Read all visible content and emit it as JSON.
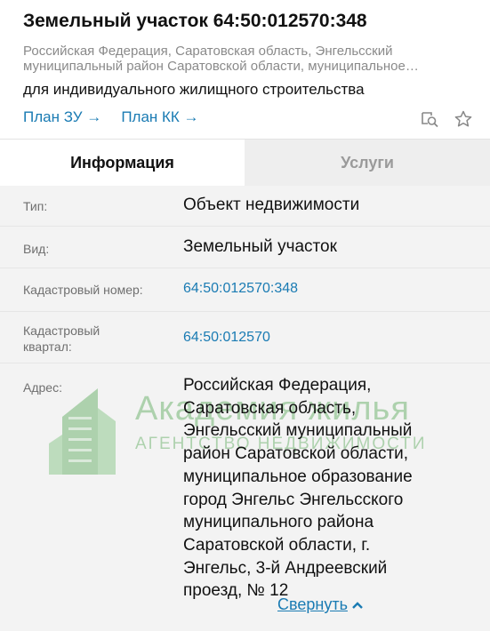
{
  "header": {
    "title": "Земельный участок 64:50:012570:348",
    "subtitle_line1": "Российская Федерация, Саратовская область, Энгельсский",
    "subtitle_line2": "муниципальный район Саратовской области, муниципальное…",
    "purpose": "для индивидуального жилищного строительства",
    "link_plan_zu": "План ЗУ →",
    "link_plan_kk": "План КК →",
    "icons": [
      "map-search-icon",
      "star-icon"
    ]
  },
  "tabs": [
    {
      "label": "Информация",
      "active": true
    },
    {
      "label": "Услуги",
      "active": false
    }
  ],
  "info": {
    "type_label": "Тип:",
    "type_value": "Объект недвижимости",
    "kind_label": "Вид:",
    "kind_value": "Земельный участок",
    "cadastral_number_label": "Кадастровый номер:",
    "cadastral_number_value": "64:50:012570:348",
    "cadastral_quarter_label_line1": "Кадастровый",
    "cadastral_quarter_label_line2": "квартал:",
    "cadastral_quarter_value": "64:50:012570",
    "address_label": "Адрес:",
    "address_lines": [
      "Российская Федерация,",
      "Саратовская область,",
      "Энгельсский муниципальный",
      "район Саратовской области,",
      "муниципальное образование",
      "город Энгельс Энгельсского",
      "муниципального района",
      "Саратовской области, г.",
      "Энгельс, 3-й Андреевский",
      "проезд, № 12"
    ],
    "collapse_label": "Свернуть"
  },
  "watermark": {
    "title": "Академия жилья",
    "subtitle": "АГЕНТСТВО НЕДВИЖИМОСТИ"
  },
  "colors": {
    "link": "#1a7bb3",
    "muted": "#8a8a8a",
    "watermark": "#5aaa5a"
  }
}
